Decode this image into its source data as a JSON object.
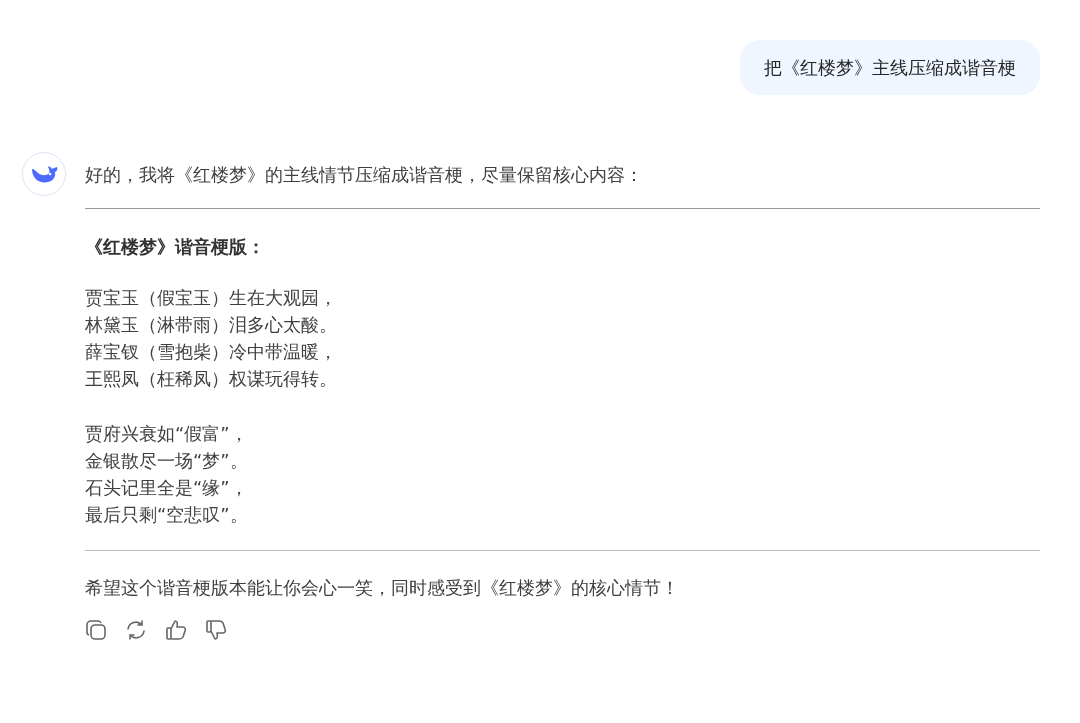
{
  "user_message": "把《红楼梦》主线压缩成谐音梗",
  "assistant": {
    "intro": "好的，我将《红楼梦》的主线情节压缩成谐音梗，尽量保留核心内容：",
    "heading": "《红楼梦》谐音梗版：",
    "stanzas": [
      [
        "贾宝玉（假宝玉）生在大观园，",
        "林黛玉（淋带雨）泪多心太酸。",
        "薛宝钗（雪抱柴）冷中带温暖，",
        "王熙凤（枉稀凤）权谋玩得转。"
      ],
      [
        "贾府兴衰如“假富”，",
        "金银散尽一场“梦”。",
        "石头记里全是“缘”，",
        "最后只剩“空悲叹”。"
      ]
    ],
    "closing": "希望这个谐音梗版本能让你会心一笑，同时感受到《红楼梦》的核心情节！"
  }
}
